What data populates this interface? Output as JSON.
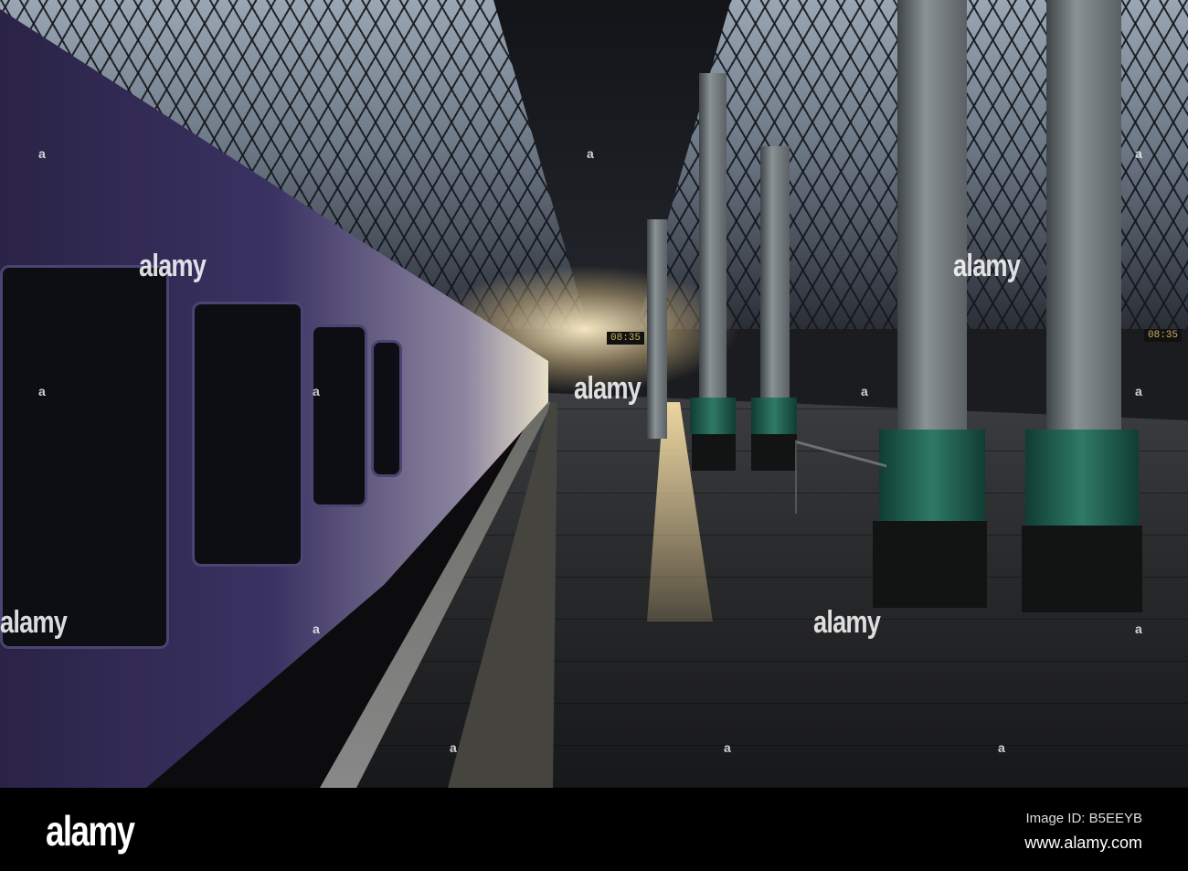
{
  "photo": {
    "description_alt": "",
    "clocks": [
      "08:35",
      "08:35"
    ],
    "watermark": "alamy",
    "watermark_marks": [
      "a",
      "a",
      "a",
      "a",
      "a",
      "a",
      "a",
      "a",
      "a",
      "a",
      "a",
      "a"
    ]
  },
  "footer": {
    "logo": "alamy",
    "image_id": "Image ID: B5EEYB",
    "website": "www.alamy.com"
  }
}
